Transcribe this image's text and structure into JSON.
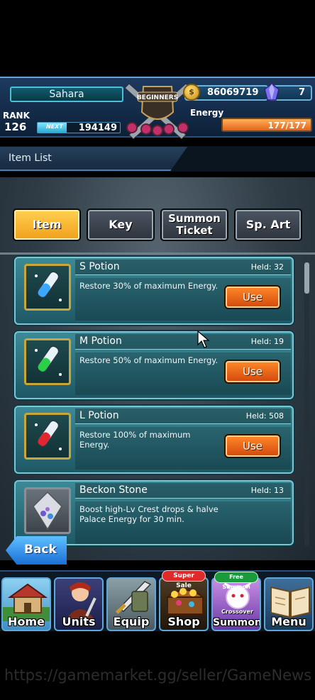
{
  "header": {
    "player_name": "Sahara",
    "rank_label": "RANK",
    "rank_value": "126",
    "next_label": "NEXT",
    "next_value": "194149",
    "next_fraction": 0.35,
    "emblem_text": "BEGINNERS",
    "gold_value": "86069719",
    "gem_value": "7",
    "energy_label": "Energy",
    "energy_value": "177/177",
    "energy_fraction": 1.0
  },
  "title": {
    "text": "Item List"
  },
  "tabs": [
    {
      "label": "Item",
      "active": true
    },
    {
      "label": "Key",
      "active": false
    },
    {
      "label_line1": "Summon",
      "label_line2": "Ticket",
      "active": false
    },
    {
      "label": "Sp. Art",
      "active": false
    }
  ],
  "items": [
    {
      "name": "S Potion",
      "held": "Held: 32",
      "description": "Restore 30% of maximum Energy.",
      "button": "Use",
      "icon": "potion-icon-blue"
    },
    {
      "name": "M Potion",
      "held": "Held: 19",
      "description": "Restore 50% of maximum Energy.",
      "button": "Use",
      "icon": "potion-icon-green"
    },
    {
      "name": "L Potion",
      "held": "Held: 508",
      "description": "Restore 100% of maximum Energy.",
      "button": "Use",
      "icon": "potion-icon-red"
    },
    {
      "name": "Beckon Stone",
      "held": "Held: 13",
      "description": "Boost high-Lv Crest drops & halve Palace Energy for 30 min.",
      "icon": "crystal-icon"
    }
  ],
  "back_button": "Back",
  "nav": [
    {
      "label": "Home",
      "icon": "house-icon"
    },
    {
      "label": "Units",
      "icon": "hero-icon"
    },
    {
      "label": "Equip",
      "icon": "sword-icon"
    },
    {
      "label": "Shop",
      "icon": "treasure-chest-icon",
      "badge": "Super Sale"
    },
    {
      "label": "Summon",
      "icon": "summon-icon",
      "badge": "Free Summon",
      "sub": "Crossover"
    },
    {
      "label": "Menu",
      "icon": "book-icon"
    }
  ],
  "watermark": "https://gamemarket.gg/seller/GameNews",
  "colors": {
    "active_tab": "#f0a01a",
    "use_button": "#d3470b",
    "card_bg": "#2f7280",
    "energy_bar": "#e5641a"
  }
}
